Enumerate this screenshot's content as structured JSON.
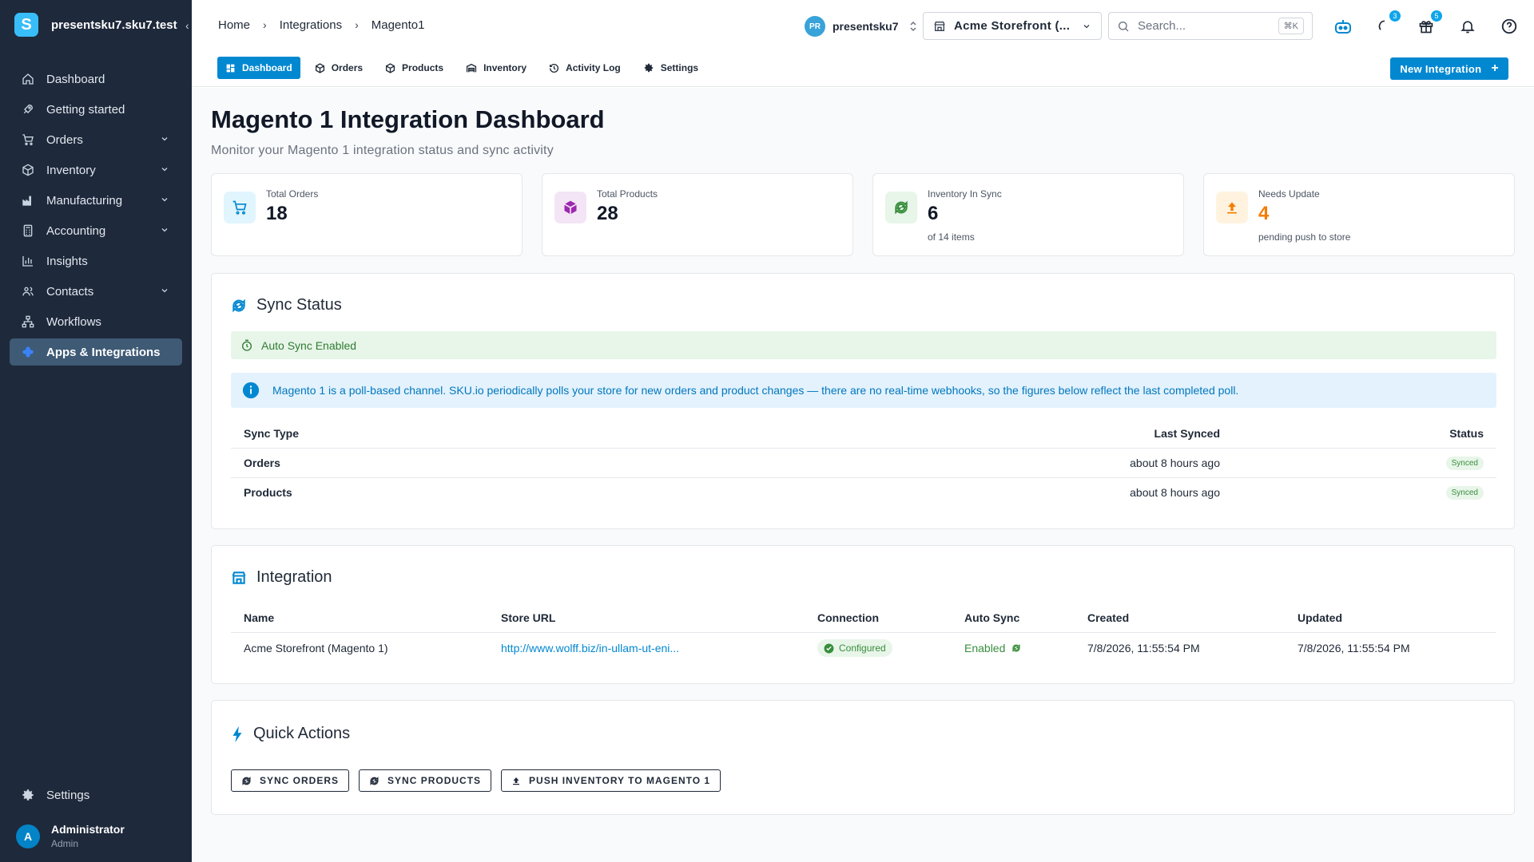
{
  "sidebar": {
    "org": "presentsku7.sku7.test",
    "logo_letter": "S",
    "collapse_glyph": "‹",
    "items": [
      {
        "label": "Dashboard",
        "icon": "home-icon"
      },
      {
        "label": "Getting started",
        "icon": "rocket-icon"
      },
      {
        "label": "Orders",
        "icon": "cart-icon"
      },
      {
        "label": "Inventory",
        "icon": "box-icon"
      },
      {
        "label": "Manufacturing",
        "icon": "factory-icon"
      },
      {
        "label": "Accounting",
        "icon": "calculator-icon"
      },
      {
        "label": "Insights",
        "icon": "bar-chart-icon"
      },
      {
        "label": "Contacts",
        "icon": "contacts-icon"
      },
      {
        "label": "Workflows",
        "icon": "workflow-icon"
      },
      {
        "label": "Apps & Integrations",
        "icon": "apps-icon"
      }
    ],
    "settings_label": "Settings",
    "user": {
      "initial": "A",
      "name": "Administrator",
      "role": "Admin"
    }
  },
  "topbar": {
    "breadcrumbs": [
      "Home",
      "Integrations",
      "Magento1"
    ],
    "project": {
      "initials": "PR",
      "name": "presentsku7"
    },
    "store_select": "Acme Storefront (...",
    "search_placeholder": "Search...",
    "search_shortcut": "⌘K",
    "badges": {
      "loading": "3",
      "gifts": "5"
    }
  },
  "tabs": [
    "Dashboard",
    "Orders",
    "Products",
    "Inventory",
    "Activity Log",
    "Settings"
  ],
  "new_integration_label": "New Integration",
  "page": {
    "title": "Magento 1 Integration Dashboard",
    "subtitle": "Monitor your Magento 1 integration status and sync activity"
  },
  "stats": [
    {
      "label": "Total Orders",
      "value": "18",
      "note": ""
    },
    {
      "label": "Total Products",
      "value": "28",
      "note": ""
    },
    {
      "label": "Inventory In Sync",
      "value": "6",
      "note": "of 14 items"
    },
    {
      "label": "Needs Update",
      "value": "4",
      "note": "pending push to store"
    }
  ],
  "sync_status": {
    "title": "Sync Status",
    "auto_sync": "Auto Sync Enabled",
    "info": "Magento 1 is a poll-based channel. SKU.io periodically polls your store for new orders and product changes — there are no real-time webhooks, so the figures below reflect the last completed poll.",
    "headers": [
      "Sync Type",
      "Last Synced",
      "Status"
    ],
    "rows": [
      {
        "type": "Orders",
        "last": "about 8 hours ago",
        "status": "Synced"
      },
      {
        "type": "Products",
        "last": "about 8 hours ago",
        "status": "Synced"
      }
    ]
  },
  "integration": {
    "title": "Integration",
    "headers": [
      "Name",
      "Store URL",
      "Connection",
      "Auto Sync",
      "Created",
      "Updated"
    ],
    "row": {
      "name": "Acme Storefront (Magento 1)",
      "url": "http://www.wolff.biz/in-ullam-ut-eni...",
      "connection": "Configured",
      "auto_sync": "Enabled",
      "created": "7/8/2026, 11:55:54 PM",
      "updated": "7/8/2026, 11:55:54 PM"
    }
  },
  "quick_actions": {
    "title": "Quick Actions",
    "buttons": [
      "SYNC ORDERS",
      "SYNC PRODUCTS",
      "PUSH INVENTORY TO MAGENTO 1"
    ]
  },
  "colors": {
    "sidebar_bg": "#1e293b",
    "accent": "#0288d1",
    "success": "#388e3c",
    "warning": "#f57c00",
    "purple": "#9c27b0"
  }
}
